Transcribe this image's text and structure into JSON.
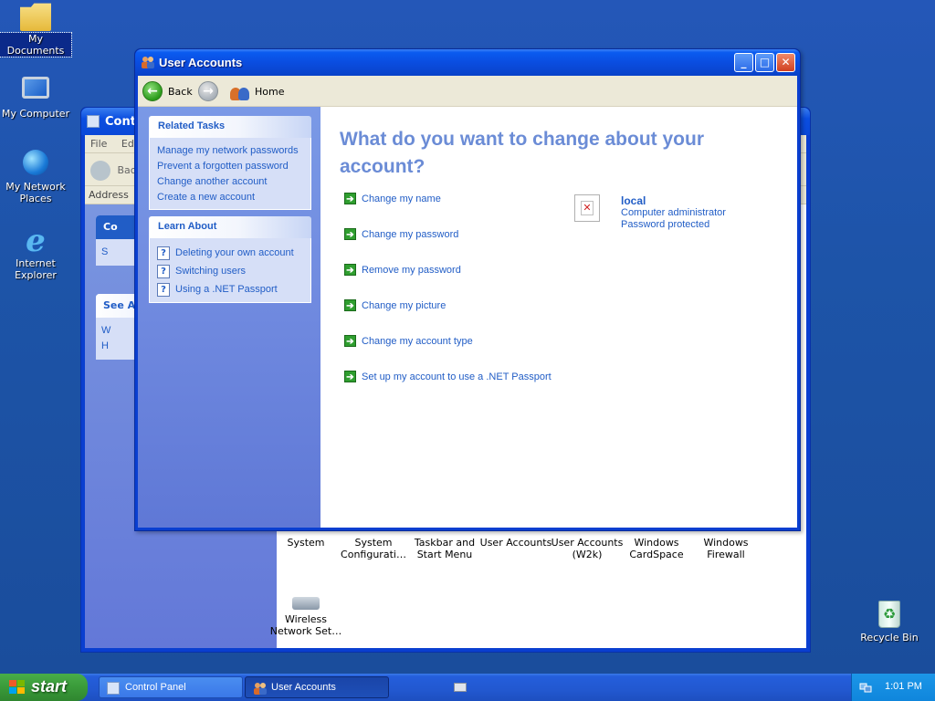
{
  "desktop": {
    "icons": [
      {
        "label": "My Documents"
      },
      {
        "label": "My Computer"
      },
      {
        "label": "My Network Places"
      },
      {
        "label": "Internet Explorer"
      },
      {
        "label": "Recycle Bin"
      }
    ]
  },
  "control_panel": {
    "title": "Contr",
    "menu": [
      "File",
      "Ed"
    ],
    "back_label": "Bac",
    "address_label": "Address",
    "left_box1_head": "Co",
    "left_box1_item": "S",
    "see_also_head": "See A",
    "see_also_items": [
      "W",
      "H"
    ],
    "bg_items": [
      {
        "label": "System"
      },
      {
        "label": "System Configurati…"
      },
      {
        "label": "Taskbar and Start Menu"
      },
      {
        "label": "User Accounts"
      },
      {
        "label": "User Accounts (W2k)"
      },
      {
        "label": "Windows CardSpace"
      },
      {
        "label": "Windows Firewall"
      },
      {
        "label": "Wireless Network Set…"
      }
    ]
  },
  "user_accounts": {
    "title": "User Accounts",
    "toolbar": {
      "back": "Back",
      "home": "Home"
    },
    "related_tasks": {
      "heading": "Related Tasks",
      "items": [
        "Manage my network passwords",
        "Prevent a forgotten password",
        "Change another account",
        "Create a new account"
      ]
    },
    "learn_about": {
      "heading": "Learn About",
      "items": [
        "Deleting your own account",
        "Switching users",
        "Using a .NET Passport"
      ]
    },
    "question": "What do you want to change about your account?",
    "actions": [
      "Change my name",
      "Change my password",
      "Remove my password",
      "Change my picture",
      "Change my account type",
      "Set up my account to use a .NET Passport"
    ],
    "account": {
      "name": "local",
      "type": "Computer administrator",
      "status": "Password protected"
    }
  },
  "taskbar": {
    "start_label": "start",
    "tasks": [
      "Control Panel",
      "User Accounts"
    ],
    "clock": "1:01 PM"
  },
  "colors": {
    "link_blue": "#215dc6",
    "heading_blue": "#6b8cd6",
    "sidebar_blue": "#6f89df",
    "title_bar": "#0a4de0",
    "go_green": "#2f9e2f"
  }
}
